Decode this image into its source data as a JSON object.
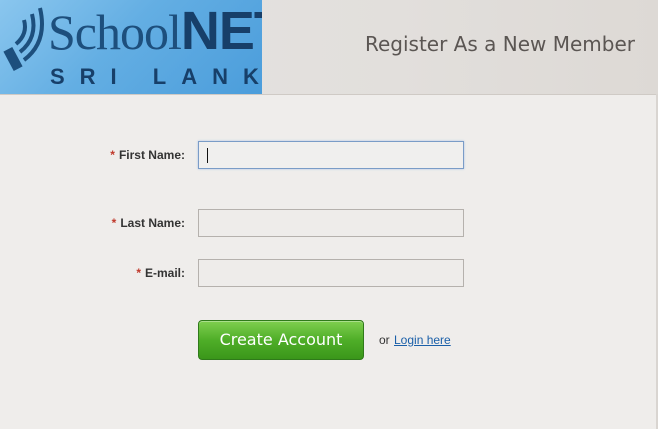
{
  "header": {
    "logo_text_main": "School",
    "logo_text_accent": "NET",
    "logo_text_sub": "SRI LANKA",
    "title": "Register As a New Member"
  },
  "form": {
    "first_name_label": "First Name:",
    "last_name_label": "Last Name:",
    "email_label": "E-mail:",
    "required_marker": "*",
    "first_name_value": "",
    "last_name_value": "",
    "email_value": ""
  },
  "actions": {
    "create_account_label": "Create Account",
    "or_text": "or",
    "login_link_label": "Login here"
  },
  "colors": {
    "create_button": "#4fae28",
    "link": "#1a5fa8",
    "required": "#c0392b",
    "logo_bg": "#63aee3"
  },
  "icons": {
    "logo_symbol": "signal-wave-icon"
  }
}
